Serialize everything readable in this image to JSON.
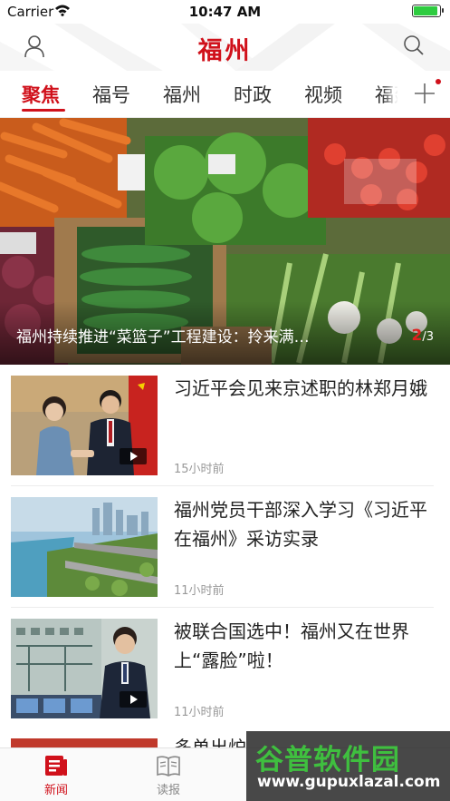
{
  "status_bar": {
    "carrier": "Carrier",
    "time": "10:47 AM",
    "battery_level": 0.95
  },
  "header": {
    "logo_text": "福州",
    "user_icon": "user-icon",
    "search_icon": "search-icon"
  },
  "tabs": [
    {
      "label": "聚焦",
      "active": true
    },
    {
      "label": "福号",
      "active": false
    },
    {
      "label": "福州",
      "active": false
    },
    {
      "label": "时政",
      "active": false
    },
    {
      "label": "视频",
      "active": false
    },
    {
      "label": "福建",
      "active": false
    }
  ],
  "banner": {
    "caption": "福州持续推进“菜篮子”工程建设：拎来满…",
    "current": "2",
    "total": "/3"
  },
  "news": [
    {
      "title": "习近平会见来京述职的林郑月娥",
      "time": "15小时前",
      "has_video": true
    },
    {
      "title": "福州党员干部深入学习《习近平在福州》采访实录",
      "time": "11小时前",
      "has_video": false
    },
    {
      "title": "被联合国选中！福州又在世界上“露脸”啦！",
      "time": "11小时前",
      "has_video": true
    }
  ],
  "partial_item": {
    "title": "多单出炉"
  },
  "tabbar": [
    {
      "label": "新闻",
      "active": true,
      "icon": "news-icon"
    },
    {
      "label": "读报",
      "active": false,
      "icon": "book-icon"
    }
  ],
  "watermark": {
    "text": "谷普软件园",
    "url": "www.gupuxlazal.com"
  },
  "colors": {
    "accent": "#d0111b",
    "battery": "#2ecc40"
  }
}
